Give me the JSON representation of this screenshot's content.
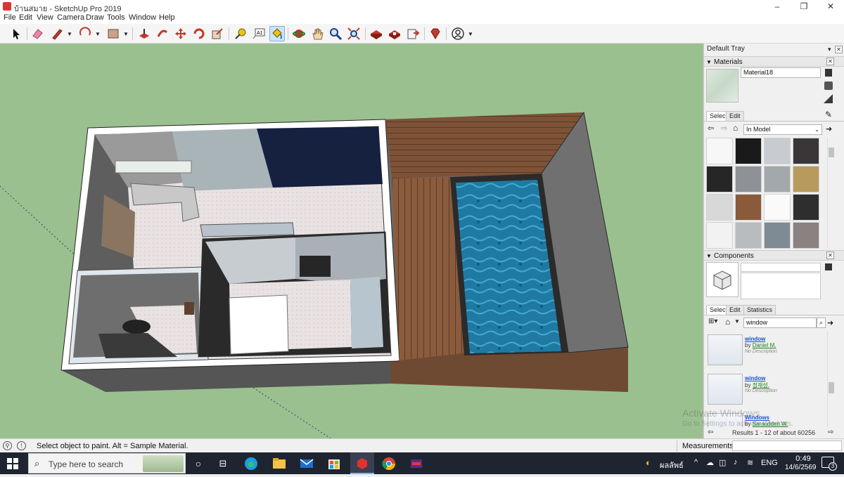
{
  "window": {
    "title": "บ้านสมาย - SketchUp Pro 2019",
    "controls": {
      "minimize": "–",
      "maximize": "❐",
      "close": "✕"
    }
  },
  "menu": [
    "File",
    "Edit",
    "View",
    "Camera",
    "Draw",
    "Tools",
    "Window",
    "Help"
  ],
  "toolbar": {
    "tools": [
      "select",
      "eraser",
      "pencil-line",
      "arc",
      "rectangle",
      "push-pull",
      "follow-me",
      "move",
      "rotate",
      "scale",
      "tape-measure",
      "text",
      "paint-bucket",
      "orbit",
      "pan",
      "zoom",
      "zoom-extents",
      "3d-warehouse",
      "extension-warehouse",
      "send-to-layout",
      "extension-manager",
      "account"
    ],
    "active_tool": "paint-bucket",
    "text_tool_label": "A1"
  },
  "tray": {
    "title": "Default Tray",
    "materials": {
      "header": "Materials",
      "current_name": "Material18",
      "tabs": [
        "Select",
        "Edit"
      ],
      "active_tab": "Select",
      "collection": "In Model",
      "swatch_colors": [
        "#f7f7f7",
        "#1a1a1a",
        "#c8ccd0",
        "#3a3638",
        "#262626",
        "#8e9296",
        "#a3a8ac",
        "#b89a5c",
        "#d8d8d8",
        "#8a5a3a",
        "#fafafa",
        "#2e2e2e",
        "#f2f2f2",
        "#b8bcbe",
        "#7e8a94",
        "#8a8280"
      ]
    },
    "components": {
      "header": "Components",
      "tabs": [
        "Select",
        "Edit",
        "Statistics"
      ],
      "active_tab": "Select",
      "search_value": "window",
      "results": [
        {
          "title": "window",
          "by_prefix": "by",
          "author": "Daniel M.",
          "desc": "No Description"
        },
        {
          "title": "window",
          "by_prefix": "by",
          "author": "정재성.",
          "desc": "No Description"
        },
        {
          "title": "Windows",
          "by_prefix": "by",
          "author": "Saraudden W.",
          "desc": ""
        }
      ],
      "results_text": "Results 1 - 12 of about 60256"
    }
  },
  "statusbar": {
    "message": "Select object to paint. Alt = Sample Material.",
    "measurements_label": "Measurements",
    "measurements_value": ""
  },
  "taskbar": {
    "search_placeholder": "Type here to search",
    "weather": "ผลลัพธ์",
    "lang": "ENG",
    "time": "0:49",
    "date": "14/6/2569",
    "notification_count": "3",
    "watermark_line1": "Activate Windows",
    "watermark_line2": "Go to Settings to activate Windows."
  }
}
